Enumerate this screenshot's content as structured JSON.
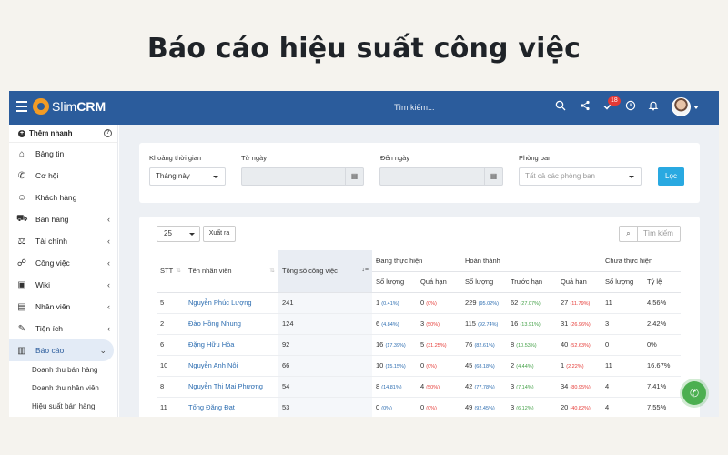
{
  "headline": "Báo cáo hiệu suất công việc",
  "topbar": {
    "logo_prefix": "Slim",
    "logo_suffix": "CRM",
    "search_placeholder": "Tìm kiếm...",
    "notification_count": "18"
  },
  "sidebar": {
    "quick_add": "Thêm nhanh",
    "items": [
      {
        "label": "Bảng tin",
        "icon": "home-icon"
      },
      {
        "label": "Cơ hội",
        "icon": "phone-icon"
      },
      {
        "label": "Khách hàng",
        "icon": "user-icon"
      },
      {
        "label": "Bán hàng",
        "icon": "cart-icon"
      },
      {
        "label": "Tài chính",
        "icon": "scale-icon"
      },
      {
        "label": "Công việc",
        "icon": "handshake-icon"
      },
      {
        "label": "Wiki",
        "icon": "vk-icon"
      },
      {
        "label": "Nhân viên",
        "icon": "id-card-icon"
      },
      {
        "label": "Tiện ích",
        "icon": "wrench-icon"
      },
      {
        "label": "Báo cáo",
        "icon": "chart-icon"
      }
    ],
    "subitems": [
      "Doanh thu bán hàng",
      "Doanh thu nhân viên",
      "Hiệu suất bán hàng"
    ]
  },
  "filter": {
    "period_label": "Khoảng thời gian",
    "period_value": "Tháng này",
    "from_label": "Từ ngày",
    "to_label": "Đến ngày",
    "dept_label": "Phòng ban",
    "dept_placeholder": "Tất cả các phòng ban",
    "submit": "Lọc"
  },
  "table": {
    "page_size": "25",
    "export": "Xuất ra",
    "search_placeholder": "Tìm kiếm",
    "headers": {
      "stt": "STT",
      "name": "Tên nhân viên",
      "total": "Tổng số công việc",
      "in_progress": "Đang thực hiện",
      "done": "Hoàn thành",
      "not_done": "Chưa thực hiện",
      "qty": "Số lượng",
      "overdue": "Quá hạn",
      "early": "Trước hạn",
      "ratio": "Tỷ lệ"
    },
    "rows": [
      {
        "stt": "5",
        "name": "Nguyễn Phúc Lượng",
        "total": "241",
        "ip_qty": "1",
        "ip_qty_pct": "(0.41%)",
        "ip_over": "0",
        "ip_over_pct": "(0%)",
        "done_qty": "229",
        "done_qty_pct": "(95.02%)",
        "done_early": "62",
        "done_early_pct": "(27.07%)",
        "done_over": "27",
        "done_over_pct": "(11.79%)",
        "nd_qty": "11",
        "nd_ratio": "4.56%"
      },
      {
        "stt": "2",
        "name": "Đào Hồng Nhung",
        "total": "124",
        "ip_qty": "6",
        "ip_qty_pct": "(4.84%)",
        "ip_over": "3",
        "ip_over_pct": "(50%)",
        "done_qty": "115",
        "done_qty_pct": "(92.74%)",
        "done_early": "16",
        "done_early_pct": "(13.91%)",
        "done_over": "31",
        "done_over_pct": "(26.96%)",
        "nd_qty": "3",
        "nd_ratio": "2.42%"
      },
      {
        "stt": "6",
        "name": "Đặng Hữu Hòa",
        "total": "92",
        "ip_qty": "16",
        "ip_qty_pct": "(17.39%)",
        "ip_over": "5",
        "ip_over_pct": "(31.25%)",
        "done_qty": "76",
        "done_qty_pct": "(82.61%)",
        "done_early": "8",
        "done_early_pct": "(10.53%)",
        "done_over": "40",
        "done_over_pct": "(52.63%)",
        "nd_qty": "0",
        "nd_ratio": "0%"
      },
      {
        "stt": "10",
        "name": "Nguyễn Anh Nôi",
        "total": "66",
        "ip_qty": "10",
        "ip_qty_pct": "(15.15%)",
        "ip_over": "0",
        "ip_over_pct": "(0%)",
        "done_qty": "45",
        "done_qty_pct": "(68.18%)",
        "done_early": "2",
        "done_early_pct": "(4.44%)",
        "done_over": "1",
        "done_over_pct": "(2.22%)",
        "nd_qty": "11",
        "nd_ratio": "16.67%"
      },
      {
        "stt": "8",
        "name": "Nguyễn Thị Mai Phương",
        "total": "54",
        "ip_qty": "8",
        "ip_qty_pct": "(14.81%)",
        "ip_over": "4",
        "ip_over_pct": "(50%)",
        "done_qty": "42",
        "done_qty_pct": "(77.78%)",
        "done_early": "3",
        "done_early_pct": "(7.14%)",
        "done_over": "34",
        "done_over_pct": "(80.95%)",
        "nd_qty": "4",
        "nd_ratio": "7.41%"
      },
      {
        "stt": "11",
        "name": "Tống Đăng Đạt",
        "total": "53",
        "ip_qty": "0",
        "ip_qty_pct": "(0%)",
        "ip_over": "0",
        "ip_over_pct": "(0%)",
        "done_qty": "49",
        "done_qty_pct": "(92.45%)",
        "done_early": "3",
        "done_early_pct": "(6.12%)",
        "done_over": "20",
        "done_over_pct": "(40.82%)",
        "nd_qty": "4",
        "nd_ratio": "7.55%"
      }
    ]
  }
}
